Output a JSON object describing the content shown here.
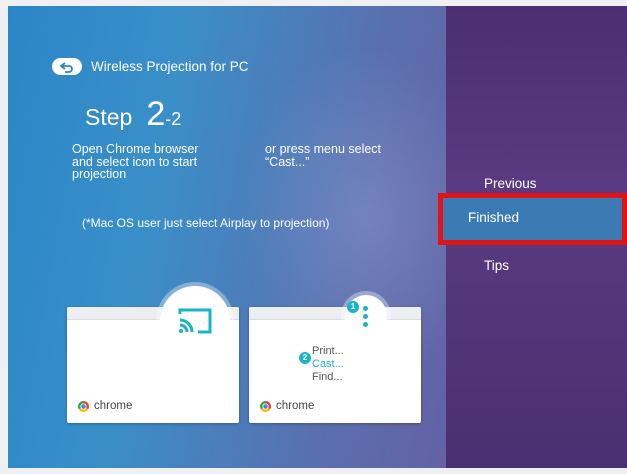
{
  "header": {
    "title": "Wireless Projection for PC"
  },
  "step": {
    "word": "Step",
    "number": "2",
    "sub": "-2"
  },
  "instructions": {
    "left": [
      "Open Chrome browser",
      "and select icon to start",
      "projection"
    ],
    "right": [
      "or press menu select",
      "“Cast...”"
    ]
  },
  "note": "(*Mac OS user just select Airplay to projection)",
  "cards": [
    {
      "brand": "chrome"
    },
    {
      "brand": "chrome",
      "menu": [
        "Print...",
        "Cast...",
        "Find..."
      ],
      "badges": [
        "1",
        "2"
      ]
    }
  ],
  "nav": {
    "items": [
      "Previous",
      "Finished",
      "Tips"
    ],
    "selected": "Finished"
  },
  "colors": {
    "accent": "#19b5c7",
    "highlight": "#e01414",
    "selected_bg": "#3b7ab3"
  }
}
